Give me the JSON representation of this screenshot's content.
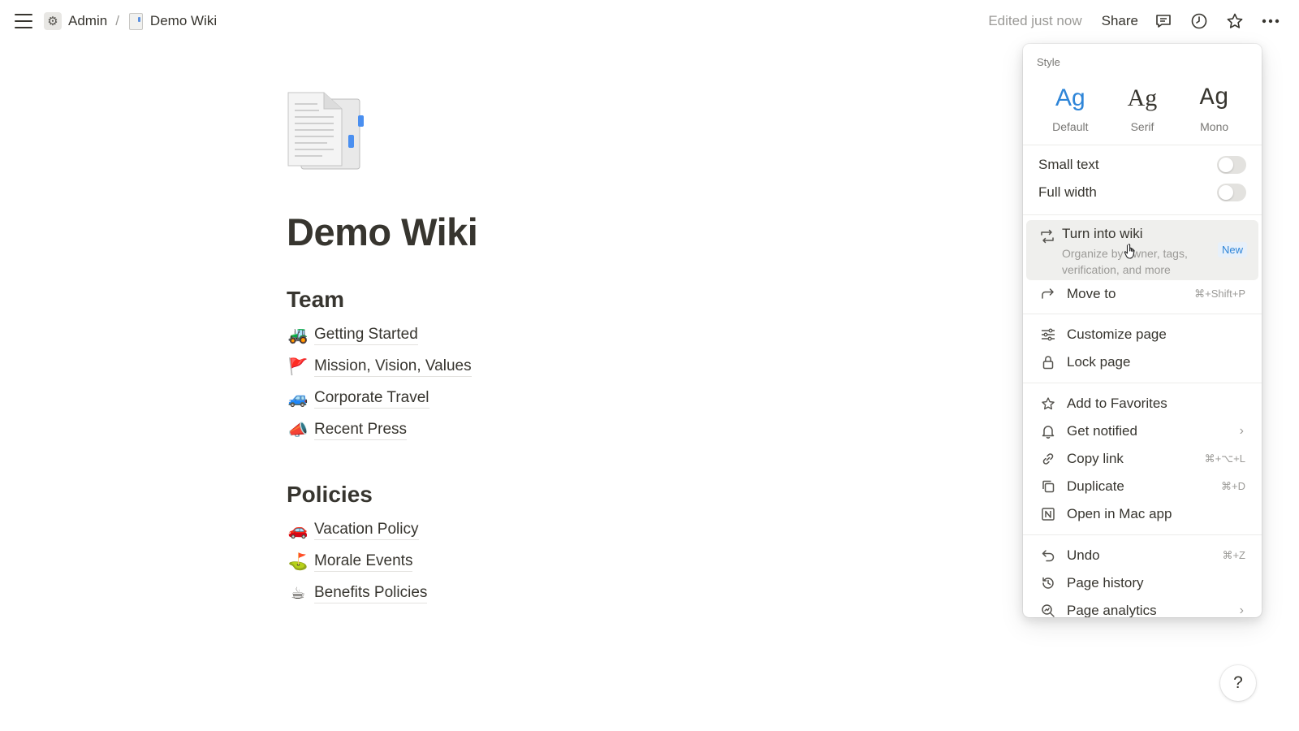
{
  "breadcrumb": {
    "workspace": "Admin",
    "separator": "/",
    "page": "Demo Wiki"
  },
  "topbar": {
    "edited": "Edited just now",
    "share": "Share"
  },
  "page": {
    "title": "Demo Wiki",
    "sections": [
      {
        "heading": "Team",
        "links": [
          {
            "emoji": "🚜",
            "label": "Getting Started"
          },
          {
            "emoji": "🚩",
            "label": "Mission, Vision, Values"
          },
          {
            "emoji": "🚙",
            "label": "Corporate Travel"
          },
          {
            "emoji": "📣",
            "label": "Recent Press"
          }
        ]
      },
      {
        "heading": "Policies",
        "links": [
          {
            "emoji": "🚗",
            "label": "Vacation Policy"
          },
          {
            "emoji": "⛳",
            "label": "Morale Events"
          },
          {
            "emoji": "☕",
            "label": "Benefits Policies"
          }
        ]
      }
    ]
  },
  "menu": {
    "style_label": "Style",
    "styles": [
      {
        "glyph": "Ag",
        "name": "Default",
        "selected": true
      },
      {
        "glyph": "Ag",
        "name": "Serif",
        "selected": false
      },
      {
        "glyph": "Ag",
        "name": "Mono",
        "selected": false
      }
    ],
    "toggles": [
      {
        "label": "Small text",
        "on": false
      },
      {
        "label": "Full width",
        "on": false
      }
    ],
    "wiki": {
      "title": "Turn into wiki",
      "description": "Organize by owner, tags, verification, and more",
      "badge": "New"
    },
    "items": {
      "move_to": {
        "label": "Move to",
        "shortcut": "⌘+Shift+P"
      },
      "customize": {
        "label": "Customize page"
      },
      "lock": {
        "label": "Lock page"
      },
      "favorites": {
        "label": "Add to Favorites"
      },
      "notified": {
        "label": "Get notified"
      },
      "copy_link": {
        "label": "Copy link",
        "shortcut": "⌘+⌥+L"
      },
      "duplicate": {
        "label": "Duplicate",
        "shortcut": "⌘+D"
      },
      "mac_app": {
        "label": "Open in Mac app"
      },
      "undo": {
        "label": "Undo",
        "shortcut": "⌘+Z"
      },
      "history": {
        "label": "Page history"
      },
      "analytics": {
        "label": "Page analytics"
      }
    }
  },
  "help": {
    "label": "?"
  },
  "colors": {
    "accent": "#2e85d8",
    "text": "#37352f",
    "muted": "#9b9a97",
    "hover": "#efefed"
  }
}
